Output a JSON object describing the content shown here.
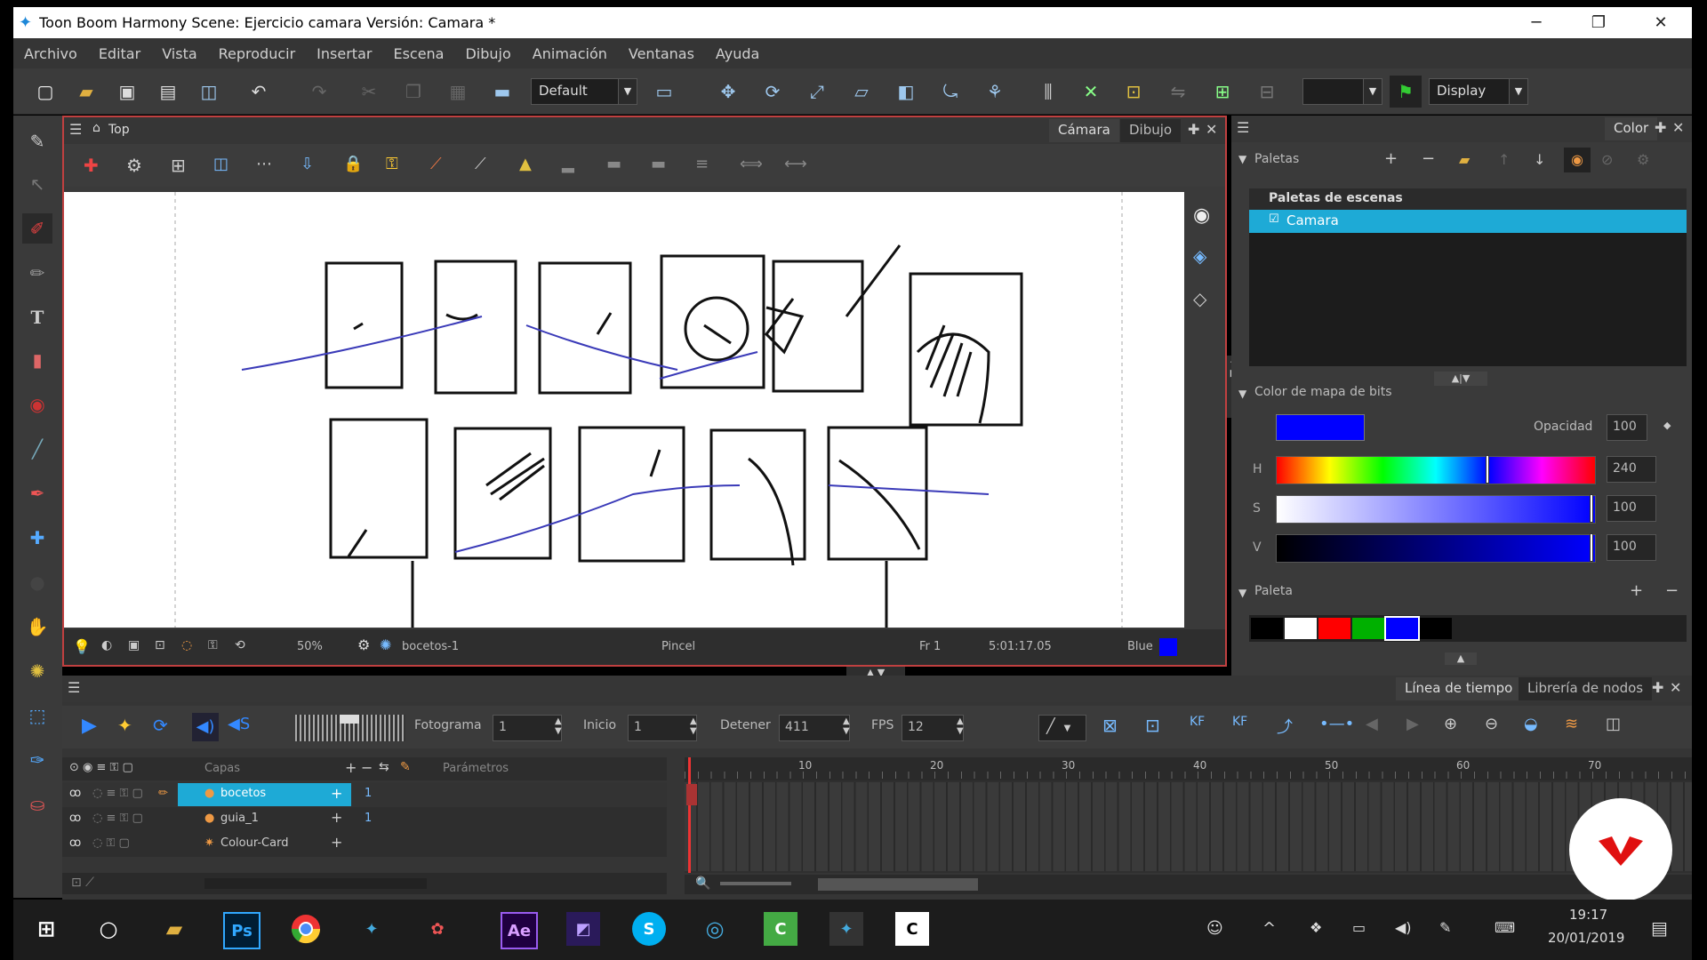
{
  "window": {
    "title": "Toon Boom Harmony Scene: Ejercicio camara Versión: Camara *",
    "controls": [
      "─",
      "❐",
      "✕"
    ]
  },
  "menu": [
    "Archivo",
    "Editar",
    "Vista",
    "Reproducir",
    "Insertar",
    "Escena",
    "Dibujo",
    "Animación",
    "Ventanas",
    "Ayuda"
  ],
  "toolbar": {
    "preset_dropdown": "Default",
    "display_dropdown": "Display"
  },
  "camera_view": {
    "location": "Top",
    "tabs": [
      "Cámara",
      "Dibujo"
    ],
    "zoom": "50%",
    "drawing_name": "bocetos-1",
    "tool_name": "Pincel",
    "frame": "Fr 1",
    "timecode": "5:01:17.05",
    "color_name": "Blue",
    "color_swatch": "#0000ff"
  },
  "color_panel": {
    "tab": "Color",
    "palettes_header": "Paletas",
    "scene_palettes_header": "Paletas de escenas",
    "selected_palette": "Camara",
    "bitmap_header": "Color de mapa de bits",
    "opacity_label": "Opacidad",
    "opacity_value": "100",
    "current_color": "#0000ff",
    "h_label": "H",
    "h_value": "240",
    "s_label": "S",
    "s_value": "100",
    "v_label": "V",
    "v_value": "100",
    "palette_header": "Paleta",
    "swatches": [
      "#000000",
      "#ffffff",
      "#ff0000",
      "#00b000",
      "#0000ff",
      "#000000"
    ]
  },
  "timeline": {
    "tabs": [
      "Línea de tiempo",
      "Librería de nodos"
    ],
    "fotograma_label": "Fotograma",
    "fotograma_value": "1",
    "inicio_label": "Inicio",
    "inicio_value": "1",
    "detener_label": "Detener",
    "detener_value": "411",
    "fps_label": "FPS",
    "fps_value": "12",
    "layers_header": "Capas",
    "params_header": "Parámetros",
    "layers": [
      {
        "name": "bocetos",
        "value": "1"
      },
      {
        "name": "guia_1",
        "value": "1"
      },
      {
        "name": "Colour-Card",
        "value": ""
      }
    ],
    "ruler_ticks": [
      "10",
      "20",
      "30",
      "40",
      "50",
      "60",
      "70"
    ]
  },
  "taskbar": {
    "apps": [
      "Ps",
      "Ae",
      "S"
    ],
    "time": "19:17",
    "date": "20/01/2019"
  }
}
